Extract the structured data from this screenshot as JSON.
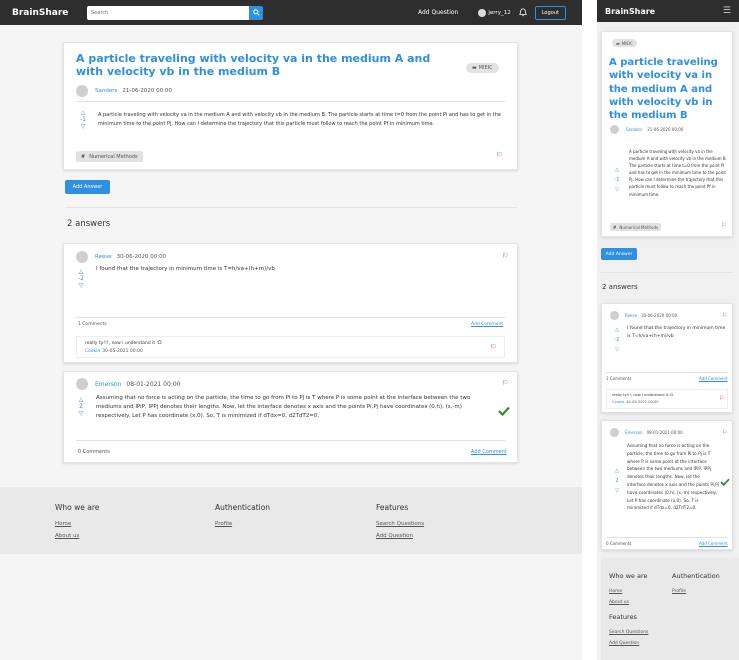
{
  "brand": "BrainShare",
  "nav": {
    "search_placeholder": "Search",
    "add_question": "Add Question",
    "user": "jerry_12",
    "logout": "Logout"
  },
  "question": {
    "title": "A particle traveling with velocity va in the medium A and with velocity vb in the medium B",
    "category": "MIEIC",
    "author": "Sanders",
    "date": "21-06-2020 00:00",
    "votes": "-1",
    "body": "A particle traveling with velocity va in the medium A and with velocity vb in the medium B. The particle starts at time t=0 from the point Pi and has to get in the minimum time to the point Pj. How can I determine the trajectory that this particle must follow to reach the point Pf in minimum time.",
    "tag": "Numerical Methods"
  },
  "add_answer": "Add Answer",
  "answers_count": "2 answers",
  "answers": [
    {
      "author": "Reese",
      "date": "30-06-2020 00:00",
      "votes": "-2",
      "body": "I found that the trajectory in minimum time is T=h/va+(h+m)/vb",
      "comments_label": "1 Comments",
      "add_comment": "Add Comment",
      "comment": {
        "text": "really ty!!!, now i understand it :D",
        "author": "Cookie",
        "date": "30-05-2021 00:00"
      }
    },
    {
      "author": "Emerson",
      "date": "08-01-2021 00:00",
      "votes": "2",
      "body": "Assuming that no force is acting on the particle, the time to go from Pi to Pj is T where P is some point at the interface between the two mediums and IPiP, IPPj denotes their lengths. Now, let the interface denotes x axis and the points Pi,Pj have coordinates (0,h), (s,-m) respectively. Let P has coordinate (x,0). So, T is minimized if dTdx=0, d2TdT2=0.",
      "comments_label": "0 Comments",
      "add_comment": "Add Comment"
    }
  ],
  "footer": {
    "who_title": "Who we are",
    "home": "Home",
    "about": "About us",
    "auth_title": "Authentication",
    "profile": "Profile",
    "features_title": "Features",
    "search_questions": "Search Questions",
    "add_question": "Add Question"
  },
  "colors": {
    "accent": "#2f8fe0",
    "nav": "#2e2e2e",
    "flag": "#dd3333",
    "check": "#2e8b2e"
  }
}
